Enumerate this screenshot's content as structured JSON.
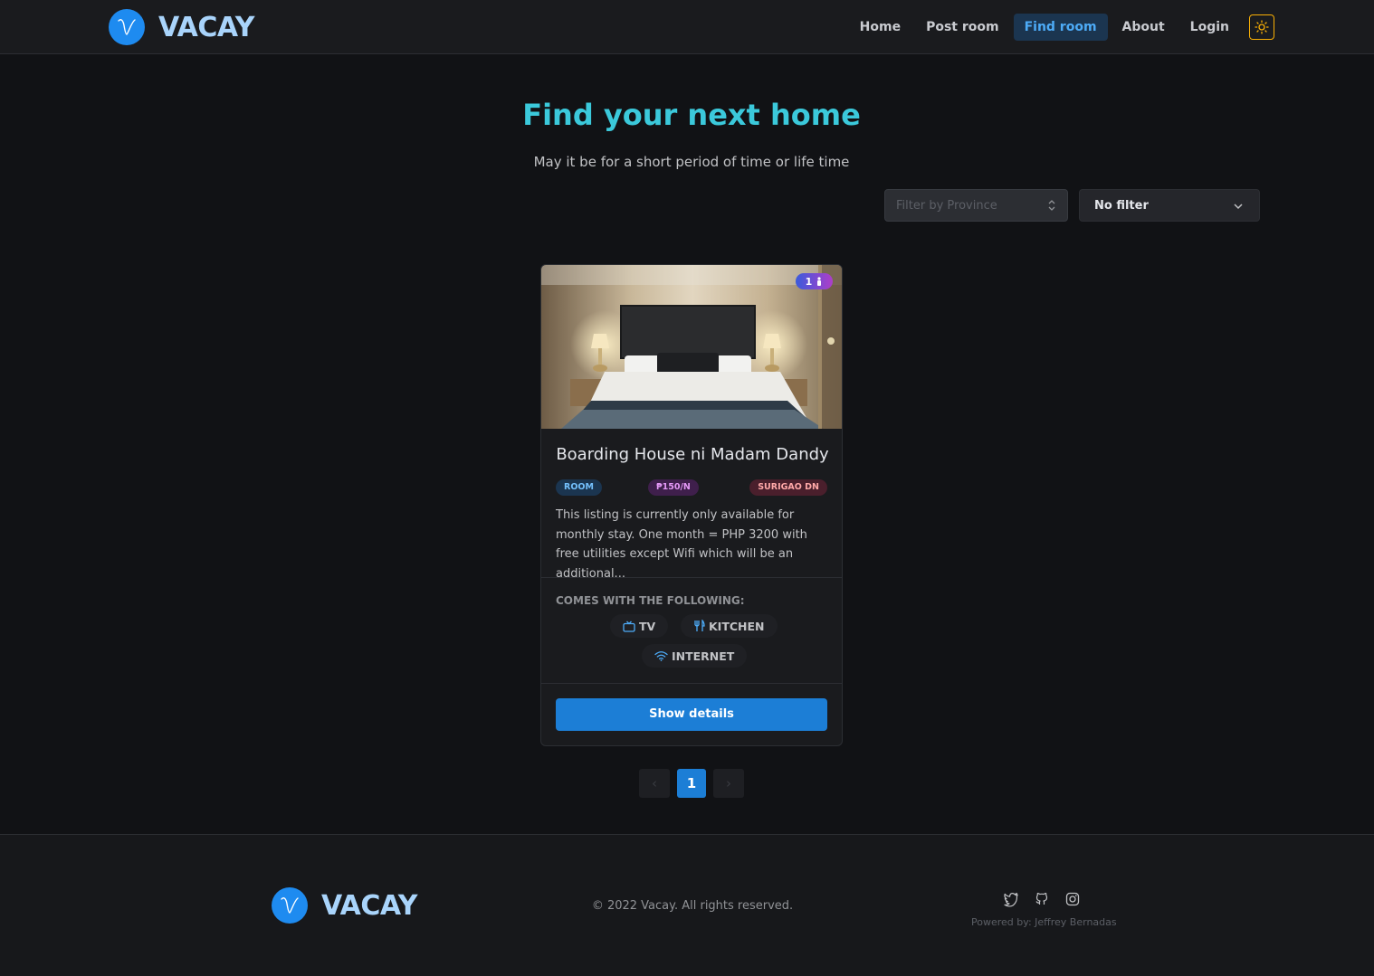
{
  "brand": {
    "name": "VACAY",
    "accent": "#1e8bf0"
  },
  "nav": {
    "items": [
      {
        "label": "Home",
        "active": false
      },
      {
        "label": "Post room",
        "active": false
      },
      {
        "label": "Find room",
        "active": true
      },
      {
        "label": "About",
        "active": false
      },
      {
        "label": "Login",
        "active": false
      }
    ],
    "theme_toggle_icon": "sun-icon"
  },
  "hero": {
    "title": "Find your next home",
    "subtitle": "May it be for a short period of time or life time"
  },
  "filters": {
    "province_placeholder": "Filter by Province",
    "filter_value": "No filter"
  },
  "listing": {
    "title": "Boarding House ni Madam Dandy",
    "occupants": "1",
    "type": "ROOM",
    "price": "₱150/N",
    "location": "SURIGAO DN",
    "description": "This listing is currently only available for monthly stay. One month = PHP 3200 with free utilities except Wifi which will be an additional...",
    "amenities_heading": "COMES WITH THE FOLLOWING:",
    "amenities": [
      {
        "label": "TV",
        "icon": "tv-icon"
      },
      {
        "label": "KITCHEN",
        "icon": "utensils-icon"
      },
      {
        "label": "INTERNET",
        "icon": "wifi-icon"
      }
    ],
    "cta": "Show details"
  },
  "pagination": {
    "prev": "‹",
    "current": "1",
    "next": "›"
  },
  "footer": {
    "brand": "VACAY",
    "copyright": "© 2022 Vacay. All rights reserved.",
    "social": [
      "twitter-icon",
      "github-icon",
      "instagram-icon"
    ],
    "powered_by": "Powered by: Jeffrey Bernadas"
  }
}
